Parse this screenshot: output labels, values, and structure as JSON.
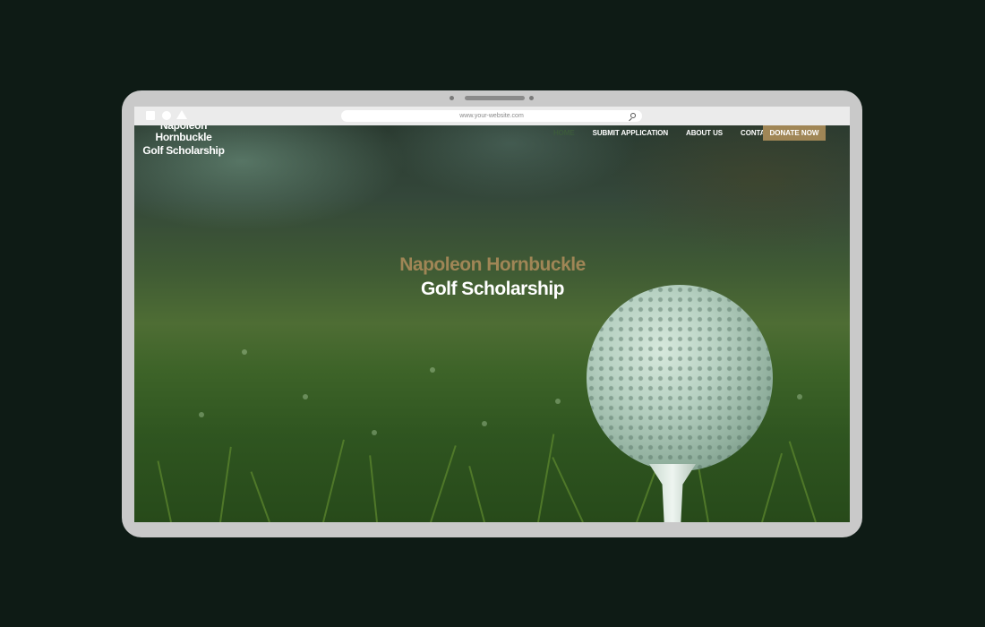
{
  "browser": {
    "url": "www.your-website.com",
    "controls": [
      "square-icon",
      "circle-icon",
      "triangle-icon"
    ],
    "search_icon": "search-icon"
  },
  "site": {
    "logo_line1": "Napoleon Hornbuckle",
    "logo_line2": "Golf Scholarship"
  },
  "nav": {
    "items": [
      {
        "label": "HOME",
        "active": true
      },
      {
        "label": "SUBMIT APPLICATION",
        "active": false
      },
      {
        "label": "ABOUT US",
        "active": false
      },
      {
        "label": "CONTACT",
        "active": false
      }
    ],
    "cta_label": "DONATE NOW"
  },
  "hero": {
    "title_line1": "Napoleon Hornbuckle",
    "title_line2": "Golf Scholarship"
  },
  "colors": {
    "page_background": "#0e1b15",
    "device_frame": "#c9c9c9",
    "accent_gold": "#a08656",
    "active_nav": "#3c5a3c"
  }
}
